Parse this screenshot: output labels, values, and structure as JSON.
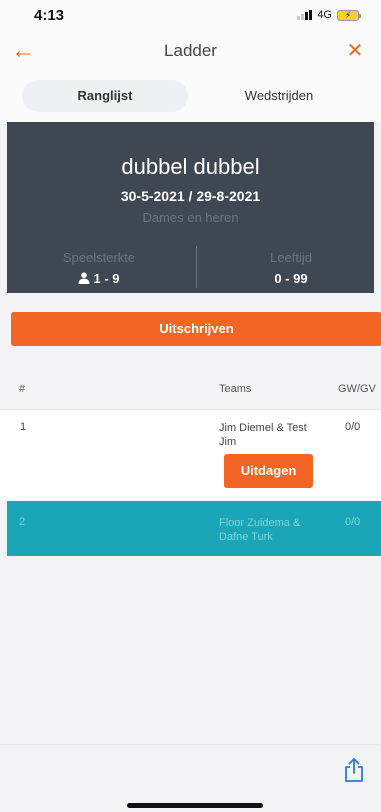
{
  "status_bar": {
    "time": "4:13",
    "network": "4G",
    "battery_icon": "battery-charging-icon"
  },
  "header": {
    "title": "Ladder",
    "back_icon": "arrow-left-icon",
    "close_icon": "close-icon"
  },
  "tabs": [
    {
      "label": "Ranglijst",
      "active": true
    },
    {
      "label": "Wedstrijden",
      "active": false
    }
  ],
  "ladder": {
    "name": "dubbel dubbel",
    "dates": "30-5-2021 / 29-8-2021",
    "gender": "Dames en heren",
    "strength_label": "Speelsterkte",
    "strength_value": "1 - 9",
    "age_label": "Leeftijd",
    "age_value": "0 - 99"
  },
  "unsubscribe_label": "Uitschrijven",
  "table": {
    "columns": [
      "#",
      "Teams",
      "GW/GV"
    ],
    "rows": [
      {
        "rank": "1",
        "team": "Jim Diemel & Test Jim",
        "score": "0/0",
        "action_label": "Uitdagen"
      },
      {
        "rank": "2",
        "team": "Floor Zuidema & Dafne Turk",
        "score": "0/0"
      }
    ]
  },
  "colors": {
    "accent": "#f26522",
    "hero_bg": "#3f4753",
    "highlight_row": "#1aa6b7"
  },
  "bottom": {
    "share_icon": "share-icon"
  }
}
